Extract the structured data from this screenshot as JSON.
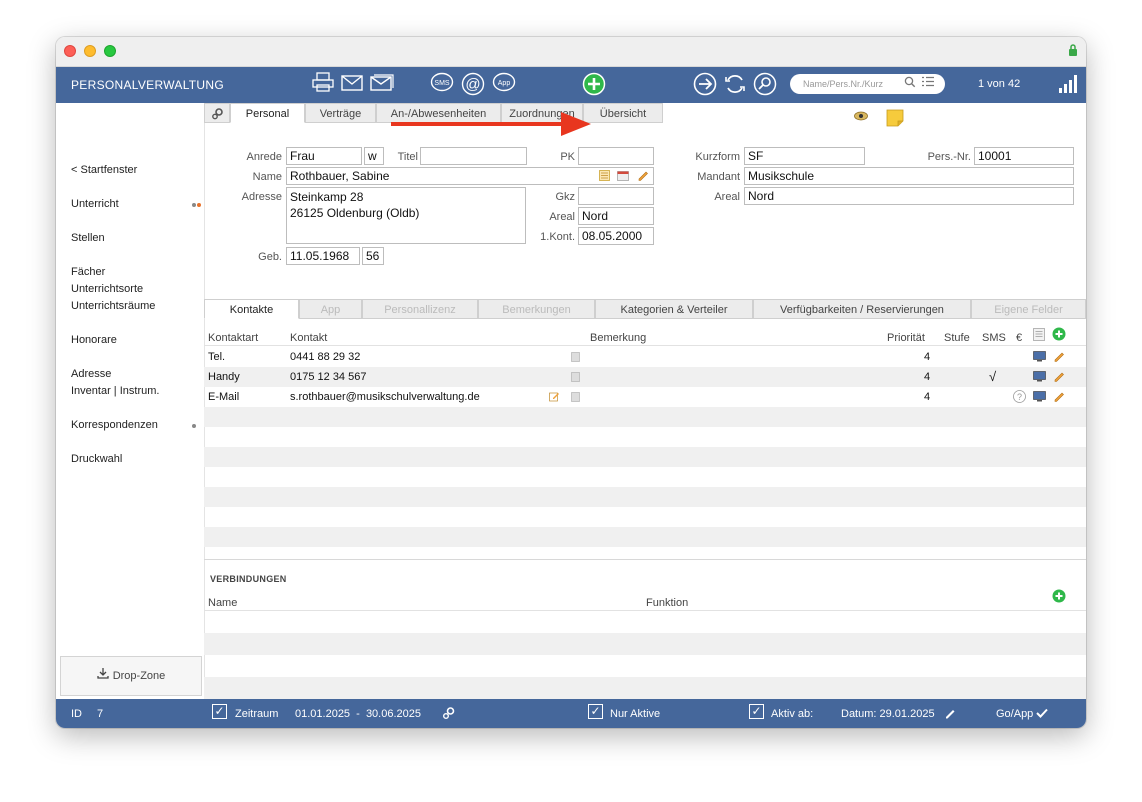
{
  "app": {
    "title": "PERSONALVERWALTUNG",
    "record_counter": "1 von 42"
  },
  "search": {
    "placeholder": "Name/Pers.Nr./Kurz"
  },
  "sidebar": {
    "items": [
      {
        "label": "< Startfenster"
      },
      {
        "label": "Unterricht"
      },
      {
        "label": "Stellen"
      },
      {
        "label": "Fächer"
      },
      {
        "label": "Unterrichtsorte"
      },
      {
        "label": "Unterrichtsräume"
      },
      {
        "label": "Honorare"
      },
      {
        "label": "Adresse"
      },
      {
        "label": "Inventar | Instrum."
      },
      {
        "label": "Korrespondenzen"
      },
      {
        "label": "Druckwahl"
      }
    ],
    "dropzone": "Drop-Zone"
  },
  "top_tabs": [
    "Personal",
    "Verträge",
    "An-/Abwesenheiten",
    "Zuordnungen",
    "Übersicht"
  ],
  "form": {
    "anrede_label": "Anrede",
    "anrede": "Frau",
    "anrede_short": "w",
    "titel_label": "Titel",
    "titel": "",
    "pk_label": "PK",
    "pk": "",
    "name_label": "Name",
    "name": "Rothbauer, Sabine",
    "adresse_label": "Adresse",
    "adresse_line1": "Steinkamp 28",
    "adresse_line2": "26125 Oldenburg (Oldb)",
    "gkz_label": "Gkz",
    "gkz": "",
    "areal_label": "Areal",
    "areal": "Nord",
    "kont_label": "1.Kont.",
    "kont": "08.05.2000",
    "geb_label": "Geb.",
    "geb": "11.05.1968",
    "alter": "56",
    "kurzform_label": "Kurzform",
    "kurzform": "SF",
    "persnr_label": "Pers.-Nr.",
    "persnr": "10001",
    "mandant_label": "Mandant",
    "mandant": "Musikschule",
    "areal2_label": "Areal",
    "areal2": "Nord"
  },
  "sub_tabs": [
    "Kontakte",
    "App",
    "Personallizenz",
    "Bemerkungen",
    "Kategorien & Verteiler",
    "Verfügbarkeiten / Reservierungen",
    "Eigene Felder"
  ],
  "contacts": {
    "headers": {
      "kontaktart": "Kontaktart",
      "kontakt": "Kontakt",
      "bemerkung": "Bemerkung",
      "prioritaet": "Priorität",
      "stufe": "Stufe",
      "sms": "SMS",
      "euro": "€"
    },
    "rows": [
      {
        "kontaktart": "Tel.",
        "kontakt": "0441 88 29 32",
        "prioritaet": "4",
        "sms": ""
      },
      {
        "kontaktart": "Handy",
        "kontakt": "0175 12 34 567",
        "prioritaet": "4",
        "sms": "√"
      },
      {
        "kontaktart": "E-Mail",
        "kontakt": "s.rothbauer@musikschulverwaltung.de",
        "prioritaet": "4",
        "sms": ""
      }
    ]
  },
  "verbindungen": {
    "title": "VERBINDUNGEN",
    "name_header": "Name",
    "funktion_header": "Funktion"
  },
  "statusbar": {
    "id_label": "ID",
    "id_value": "7",
    "zeitraum_label": "Zeitraum",
    "zeitraum_value": "01.01.2025  -  30.06.2025",
    "nur_aktive": "Nur Aktive",
    "aktiv_ab": "Aktiv ab:",
    "datum": "Datum: 29.01.2025",
    "goapp": "Go/App"
  },
  "colors": {
    "accent": "#45679b",
    "annotation_arrow": "#e8361f",
    "add_green": "#2fb84a"
  }
}
